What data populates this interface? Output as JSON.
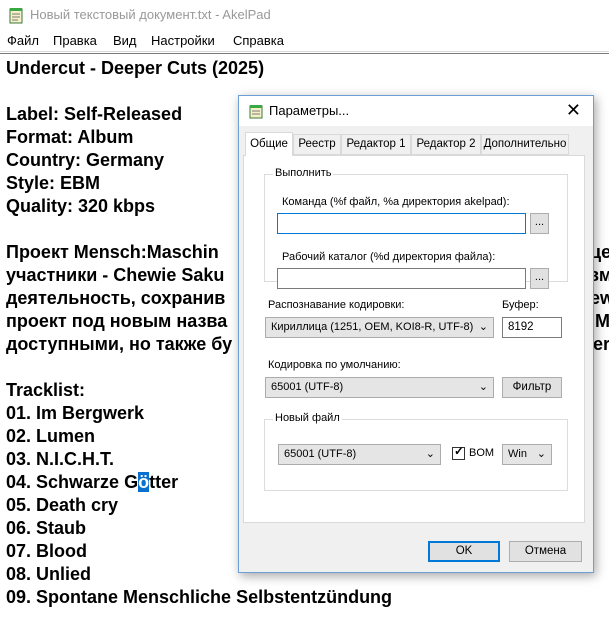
{
  "window": {
    "title": "Новый текстовый документ.txt - AkelPad"
  },
  "menu": [
    "Файл",
    "Правка",
    "Вид",
    "Настройки",
    "Справка"
  ],
  "editor": {
    "lines": [
      "Undercut - Deeper Cuts (2025)",
      "",
      "Label: Self-Released",
      "Format: Album",
      "Country: Germany",
      "Style: EBM",
      "Quality: 320 kbps",
      "",
      "Проект Mensch:Maschin",
      "участники - Chewie Saku",
      "деятельность, сохранив",
      "проект под новым назва",
      "доступными, но также бу",
      "",
      "Tracklist:",
      "01. Im Bergwerk",
      "02. Lumen",
      "03. N.I.C.H.T.",
      "04. Schwarze Götter",
      "05. Death cry",
      "06. Staub",
      "07. Blood",
      "08. Unlied",
      "09. Spontane Menschliche Selbstentzündung"
    ],
    "right_fragments": [
      "це",
      "вм",
      "ew",
      "n:M",
      "ler"
    ],
    "selection": {
      "line_index": 18,
      "before": "04. Schwarze G",
      "selected": "ö",
      "after": "tter"
    }
  },
  "dialog": {
    "title": "Параметры...",
    "close_glyph": "✕",
    "tabs": [
      "Общие",
      "Реестр",
      "Редактор 1",
      "Редактор 2",
      "Дополнительно"
    ],
    "active_tab": "Общие",
    "execute_group": {
      "legend": "Выполнить",
      "command_label": "Команда (%f файл, %a директория akelpad):",
      "command_value": "",
      "workdir_label": "Рабочий каталог (%d директория файла):",
      "workdir_value": "",
      "browse_label": "..."
    },
    "encoding_detect_label": "Распознавание кодировки:",
    "encoding_detect_value": "Кириллица (1251, OEM, KOI8-R, UTF-8)",
    "buffer_label": "Буфер:",
    "buffer_value": "8192",
    "default_encoding_label": "Кодировка по умолчанию:",
    "default_encoding_value": "65001 (UTF-8)",
    "filter_button": "Фильтр",
    "new_file_group": {
      "legend": "Новый файл",
      "encoding_value": "65001 (UTF-8)",
      "bom_label": "BOM",
      "bom_checked": true,
      "newline_value": "Win"
    },
    "ok_button": "OK",
    "cancel_button": "Отмена"
  },
  "icons": {
    "app": "notepad-icon",
    "dialog": "notepad-icon",
    "dropdown": "chevron-down-icon",
    "checkmark": "checkmark-icon"
  },
  "colors": {
    "selection": "#0b6fcf",
    "dialog_border": "#6d9fd6",
    "default_button_border": "#0078d7"
  }
}
